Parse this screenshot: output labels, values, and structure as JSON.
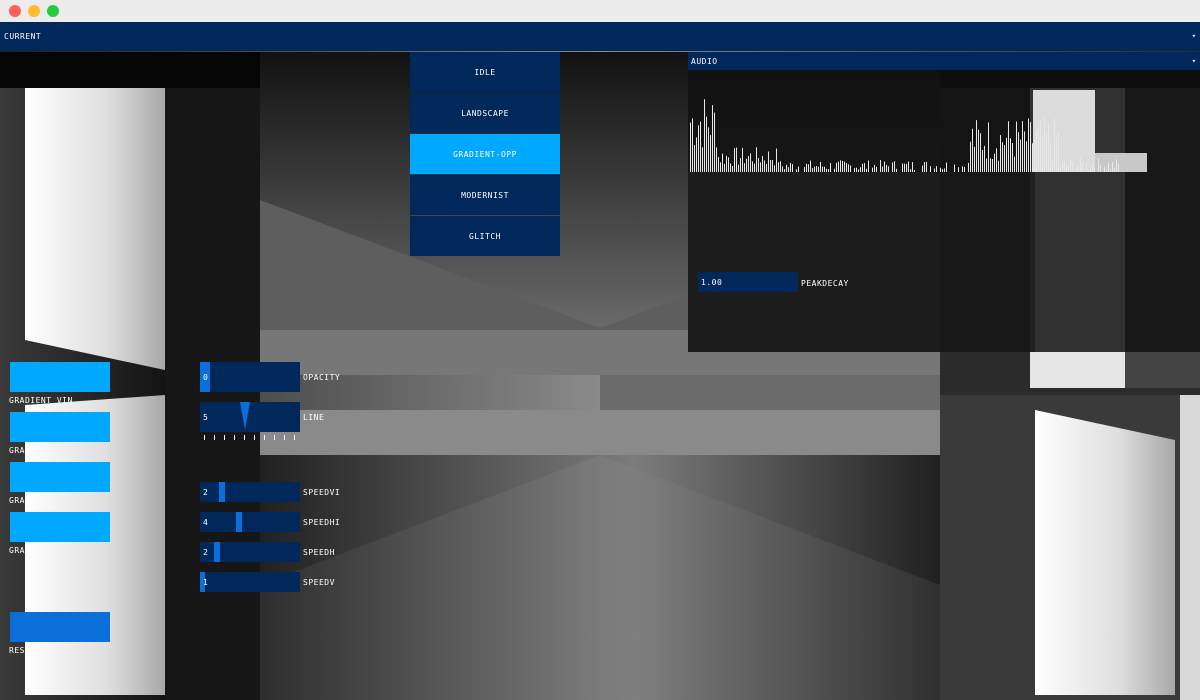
{
  "top_dropdown": {
    "label": "CURRENT",
    "caret": "▾"
  },
  "scene_menu": {
    "items": [
      "IDLE",
      "LANDSCAPE",
      "GRADIENT-OPP",
      "MODERNIST",
      "GLITCH"
    ],
    "selected": "GRADIENT-OPP"
  },
  "audio_panel": {
    "label": "AUDIO",
    "caret": "▾",
    "peakdecay": {
      "value": "1.00",
      "label": "PEAKDECAY"
    }
  },
  "left_buttons": [
    {
      "label": "GRADIENT_VIN"
    },
    {
      "label": "GRA"
    },
    {
      "label": "GRA"
    },
    {
      "label": "GRA"
    },
    {
      "label": "RES"
    }
  ],
  "sliders": {
    "opacity": {
      "value": "0",
      "label": "OPACITY"
    },
    "line": {
      "value": "5",
      "label": "LINE"
    },
    "speedvi": {
      "value": "2",
      "label": "SPEEDVI"
    },
    "speedhi": {
      "value": "4",
      "label": "SPEEDHI"
    },
    "speedh": {
      "value": "2",
      "label": "SPEEDH"
    },
    "speedv": {
      "value": "1",
      "label": "SPEEDV"
    }
  },
  "colors": {
    "panel": "#00285a",
    "accent": "#00a8ff",
    "handle": "#0a6fd8",
    "window_close": "#ff5f57",
    "window_minimize": "#febc2e",
    "window_zoom": "#28c840"
  }
}
